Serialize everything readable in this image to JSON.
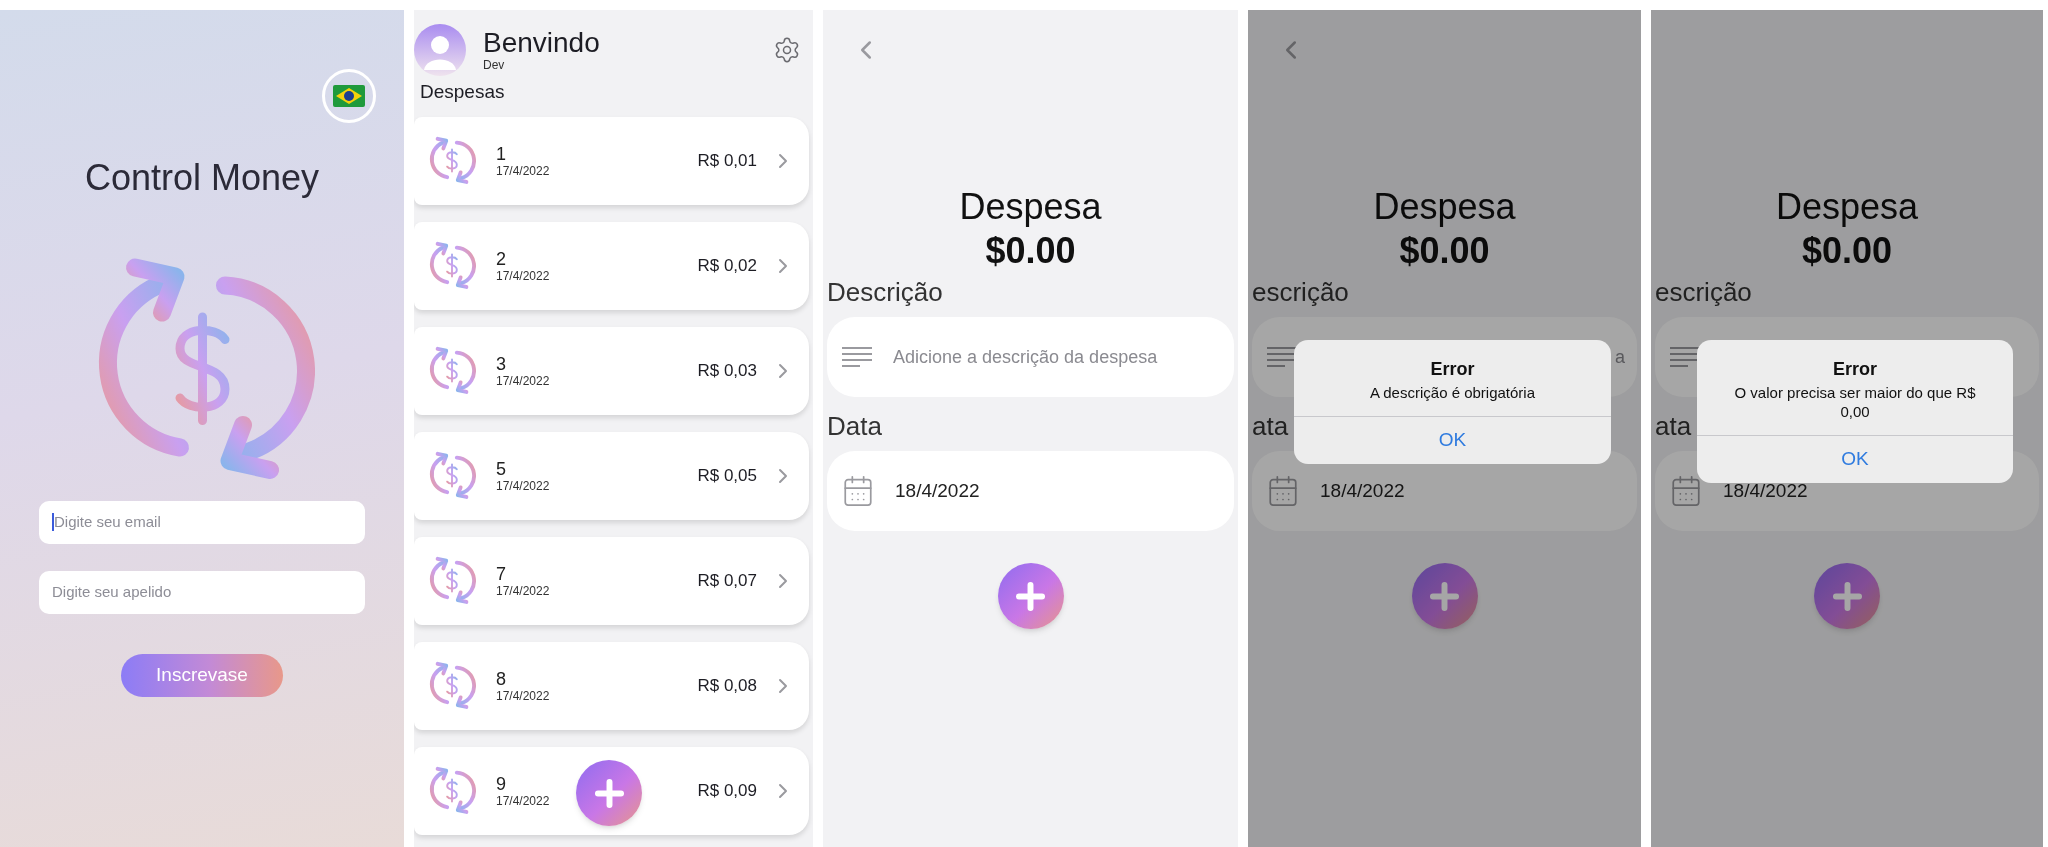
{
  "screens": [
    {
      "kind": "login",
      "title": "Control Money",
      "fields": [
        {
          "placeholder": "Digite seu email",
          "focused": true
        },
        {
          "placeholder": "Digite seu apelido",
          "focused": false
        }
      ],
      "button": "Inscrevase"
    },
    {
      "kind": "list",
      "greeting": "Benvindo",
      "user": "Dev",
      "section": "Despesas",
      "items": [
        {
          "name": "1",
          "date": "17/4/2022",
          "amount": "R$ 0,01"
        },
        {
          "name": "2",
          "date": "17/4/2022",
          "amount": "R$ 0,02"
        },
        {
          "name": "3",
          "date": "17/4/2022",
          "amount": "R$ 0,03"
        },
        {
          "name": "5",
          "date": "17/4/2022",
          "amount": "R$ 0,05"
        },
        {
          "name": "7",
          "date": "17/4/2022",
          "amount": "R$ 0,07"
        },
        {
          "name": "8",
          "date": "17/4/2022",
          "amount": "R$ 0,08"
        },
        {
          "name": "9",
          "date": "17/4/2022",
          "amount": "R$ 0,09"
        }
      ]
    },
    {
      "kind": "form",
      "back": true,
      "title": "Despesa",
      "amount": "$0.00",
      "description_label": "Descrição",
      "description_placeholder": "Adicione a descrição da despesa",
      "date_label": "Data",
      "date": "18/4/2022"
    },
    {
      "kind": "form",
      "back": true,
      "title": "Despesa",
      "amount": "$0.00",
      "description_label": "escrição",
      "description_placeholder": "a",
      "date_label": "ata",
      "date": "18/4/2022",
      "alert": {
        "title": "Error",
        "message": "A descrição é obrigatória",
        "button": "OK"
      }
    },
    {
      "kind": "form",
      "back": false,
      "title": "Despesa",
      "amount": "$0.00",
      "description_label": "escrição",
      "date_label": "ata",
      "date": "18/4/2022",
      "alert": {
        "title": "Error",
        "message": "O valor precisa ser maior do que R$ 0,00",
        "button": "OK"
      }
    }
  ]
}
